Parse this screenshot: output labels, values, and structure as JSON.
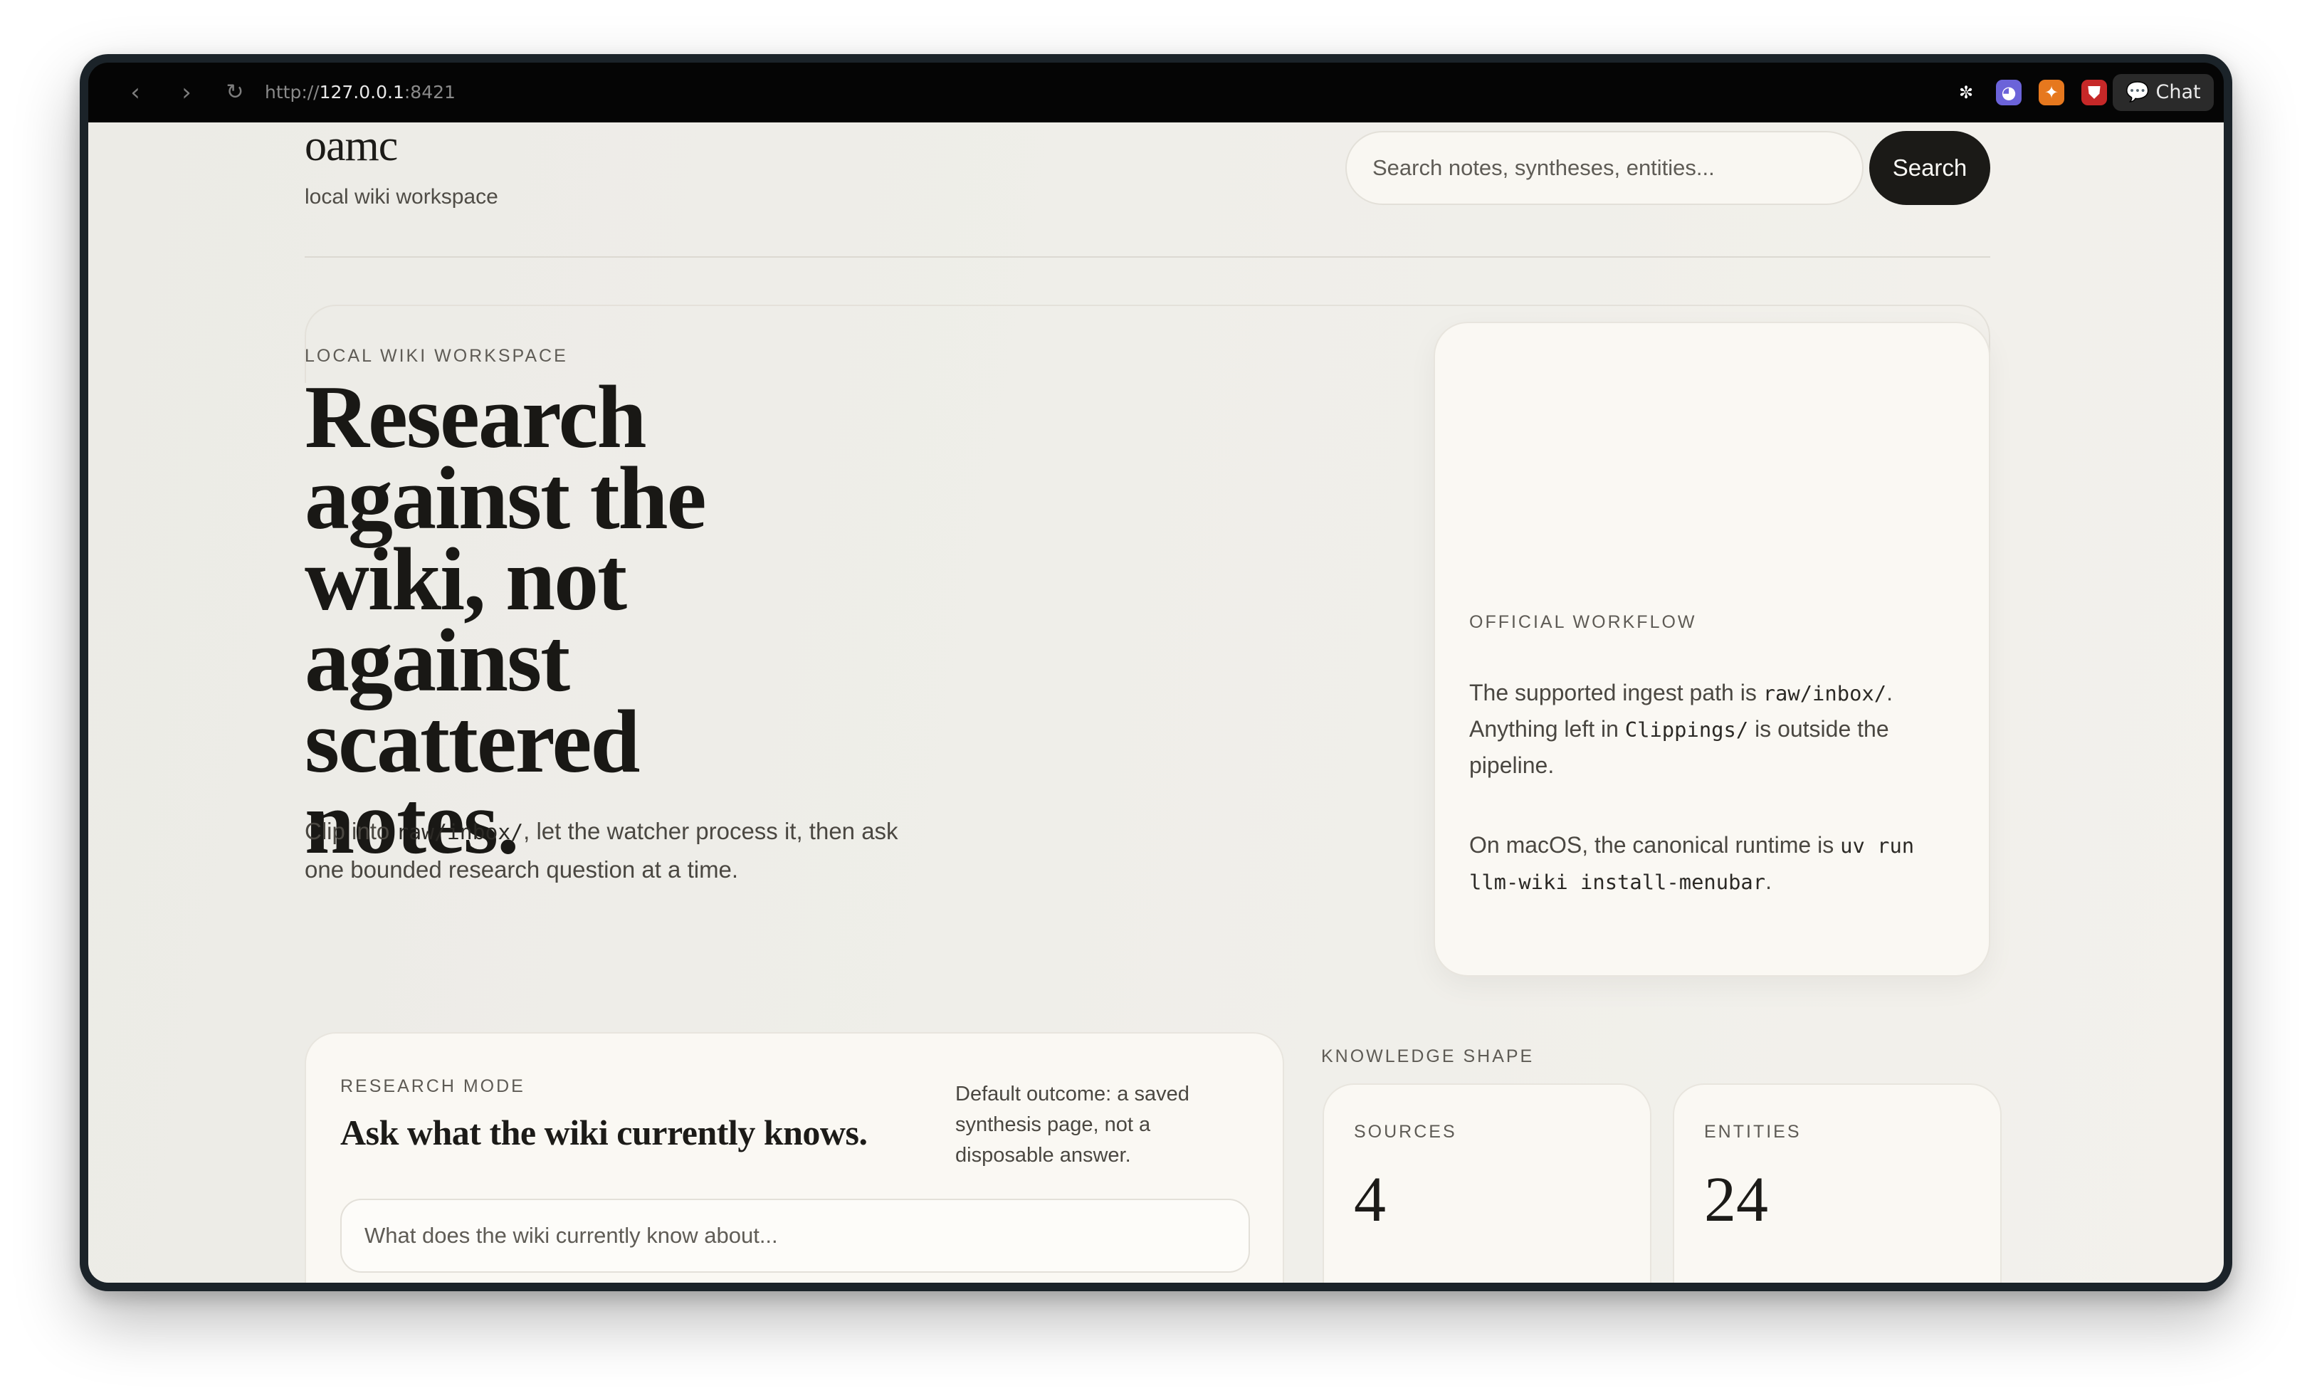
{
  "browser": {
    "url_scheme": "http://",
    "url_host": "127.0.0.1",
    "url_port": ":8421",
    "nav": {
      "back": "‹",
      "forward": "›",
      "reload": "↻"
    },
    "extensions": [
      {
        "icon": "extension-butterfly-icon",
        "glyph": "✼",
        "color": "#1a1a1a"
      },
      {
        "icon": "extension-ghost-icon",
        "glyph": "◕",
        "color": "#6b63d9"
      },
      {
        "icon": "extension-fox-icon",
        "glyph": "✦",
        "color": "#e6781e"
      },
      {
        "icon": "extension-shield-icon",
        "glyph": "⛊",
        "color": "#c62828"
      }
    ],
    "chat_label": "Chat"
  },
  "header": {
    "brand": "oamc",
    "tagline": "local wiki workspace",
    "search_placeholder": "Search notes, syntheses, entities...",
    "search_button": "Search"
  },
  "hero": {
    "eyebrow": "LOCAL WIKI WORKSPACE",
    "title": "Research against the wiki, not against scattered notes.",
    "sub_before": "Clip into ",
    "sub_code": "raw/inbox/",
    "sub_after": ", let the watcher process it, then ask one bounded research question at a time."
  },
  "workflow": {
    "eyebrow": "OFFICIAL WORKFLOW",
    "p1_before": "The supported ingest path is ",
    "p1_code1": "raw/inbox/",
    "p1_mid": ". Anything left in ",
    "p1_code2": "Clippings/",
    "p1_after": " is outside the pipeline.",
    "p2_before": "On macOS, the canonical runtime is ",
    "p2_code": "uv run llm-wiki install-menubar",
    "p2_after": "."
  },
  "research": {
    "eyebrow": "RESEARCH MODE",
    "title": "Ask what the wiki currently knows.",
    "note": "Default outcome: a saved synthesis page, not a disposable answer.",
    "input_placeholder": "What does the wiki currently know about..."
  },
  "knowledge": {
    "eyebrow": "KNOWLEDGE SHAPE",
    "stats": [
      {
        "label": "SOURCES",
        "value": "4"
      },
      {
        "label": "ENTITIES",
        "value": "24"
      }
    ]
  }
}
